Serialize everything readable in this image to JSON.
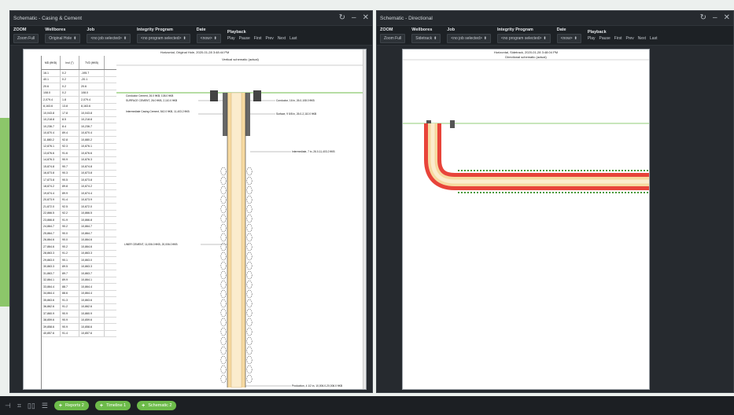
{
  "left_window": {
    "title": "Schematic - Casing & Cement",
    "zoom_label": "ZOOM",
    "zoom_button": "Zoom Full",
    "wellbores_label": "Wellbores",
    "wellbores_value": "Original Hole",
    "job_label": "Job",
    "job_value": "<no job selected>",
    "integrity_label": "Integrity Program",
    "integrity_value": "<no program selected>",
    "date_label": "Date",
    "date_value": "<now>",
    "playback_label": "Playback",
    "playback_buttons": [
      "Play",
      "Pause",
      "First",
      "Prev",
      "Next",
      "Last"
    ],
    "header_line": "Horizontal, Original Hole, 2020-01-28 3:48:44 PM",
    "schematic_title": "Vertical schematic (actual)",
    "table_headers": [
      "MD (ftKB)",
      "Incl (°)",
      "TVD (ftKB)"
    ],
    "table_rows": [
      [
        "16.1",
        "0.2",
        "-195.7"
      ],
      [
        "40.1",
        "0.2",
        "-20.1"
      ],
      [
        "20.6",
        "0.2",
        "20.6"
      ],
      [
        "108.0",
        "0.2",
        "108.0"
      ],
      [
        "2,079.4",
        "1.8",
        "2,079.4"
      ],
      [
        "8,163.6",
        "13.8",
        "8,163.6"
      ],
      [
        "10,043.8",
        "17.8",
        "10,043.8"
      ],
      [
        "10,218.8",
        "8.5",
        "10,218.8"
      ],
      [
        "10,236.7",
        "8.4",
        "10,236.7"
      ],
      [
        "10,870.4",
        "89.4",
        "10,870.4"
      ],
      [
        "11,880.2",
        "92.8",
        "10,880.2"
      ],
      [
        "12,876.1",
        "92.3",
        "10,876.1"
      ],
      [
        "13,876.6",
        "91.6",
        "10,876.6"
      ],
      [
        "14,876.3",
        "90.9",
        "10,876.3"
      ],
      [
        "15,874.8",
        "90.7",
        "10,874.8"
      ],
      [
        "16,873.8",
        "90.3",
        "10,873.8"
      ],
      [
        "17,873.8",
        "90.5",
        "10,873.8"
      ],
      [
        "18,874.2",
        "89.8",
        "10,874.2"
      ],
      [
        "19,874.4",
        "89.9",
        "10,874.4"
      ],
      [
        "20,873.9",
        "91.4",
        "10,873.9"
      ],
      [
        "21,872.0",
        "92.5",
        "10,872.0"
      ],
      [
        "22,866.5",
        "92.2",
        "10,866.5"
      ],
      [
        "23,866.8",
        "91.9",
        "10,866.8"
      ],
      [
        "24,864.7",
        "90.2",
        "10,864.7"
      ],
      [
        "25,864.7",
        "90.0",
        "10,864.7"
      ],
      [
        "26,864.6",
        "90.0",
        "10,864.6"
      ],
      [
        "27,864.6",
        "90.2",
        "10,864.6"
      ],
      [
        "28,863.3",
        "91.2",
        "10,863.3"
      ],
      [
        "29,863.0",
        "90.1",
        "10,863.0"
      ],
      [
        "30,863.3",
        "89.5",
        "10,863.3"
      ],
      [
        "31,863.7",
        "89.7",
        "10,863.7"
      ],
      [
        "32,864.1",
        "89.9",
        "10,864.1"
      ],
      [
        "33,864.4",
        "88.7",
        "10,864.4"
      ],
      [
        "34,864.4",
        "88.6",
        "10,864.4"
      ],
      [
        "35,863.6",
        "91.3",
        "10,863.6"
      ],
      [
        "36,862.6",
        "91.2",
        "10,862.6"
      ],
      [
        "37,860.9",
        "90.9",
        "10,860.9"
      ],
      [
        "38,859.6",
        "90.9",
        "10,859.6"
      ],
      [
        "39,858.6",
        "90.9",
        "10,858.6"
      ],
      [
        "40,857.6",
        "91.4",
        "10,857.6"
      ]
    ],
    "annotations": {
      "conductor_cement": "Conductor Cement, 26.0 ftKB, 108.0 ftKB",
      "surface_cement": "SURFACE CEMENT, 26.0 ftKB, 2,110.0 ftKB",
      "intermediate_cement": "Intermediate Casing Cement, 542.0 ftKB, 11,403.2 ftKB",
      "conductor_casing": "Conductor, 16 in, 26.0-108.0 ftKB",
      "surface_casing": "Surface, 9 5/8 in, 26.0-2,110.0 ftKB",
      "intermediate_casing": "Intermediate, 7 in, 26.0-11,403.2 ftKB",
      "liner_cement": "LINER CEMENT, 11,006.0 ftKB, 20,006.0 ftKB",
      "production_casing": "Production, 4 1/2 in, 10,006.0-20,006.0 ftKB"
    }
  },
  "right_window": {
    "title": "Schematic - Directional",
    "zoom_label": "ZOOM",
    "zoom_button": "Zoom Full",
    "wellbores_label": "Wellbores",
    "wellbores_value": "Sidetrack",
    "job_label": "Job",
    "job_value": "<no job selected>",
    "integrity_label": "Integrity Program",
    "integrity_value": "<no program selected>",
    "date_label": "Date",
    "date_value": "<now>",
    "playback_label": "Playback",
    "playback_buttons": [
      "Play",
      "Pause",
      "First",
      "Prev",
      "Next",
      "Last"
    ],
    "header_line": "Horizontal, Sidetrack, 2020-01-28 3:48:04 PM",
    "schematic_title": "Directional schematic (actual)"
  },
  "taskbar": {
    "tabs": [
      "Reports 2",
      "Timeline 1",
      "Schematic 2"
    ]
  },
  "colors": {
    "accent_green": "#6dbb4a",
    "panel_bg": "#262a2f",
    "cement_red": "#e8443a",
    "casing_fill": "#f6d9a0"
  }
}
